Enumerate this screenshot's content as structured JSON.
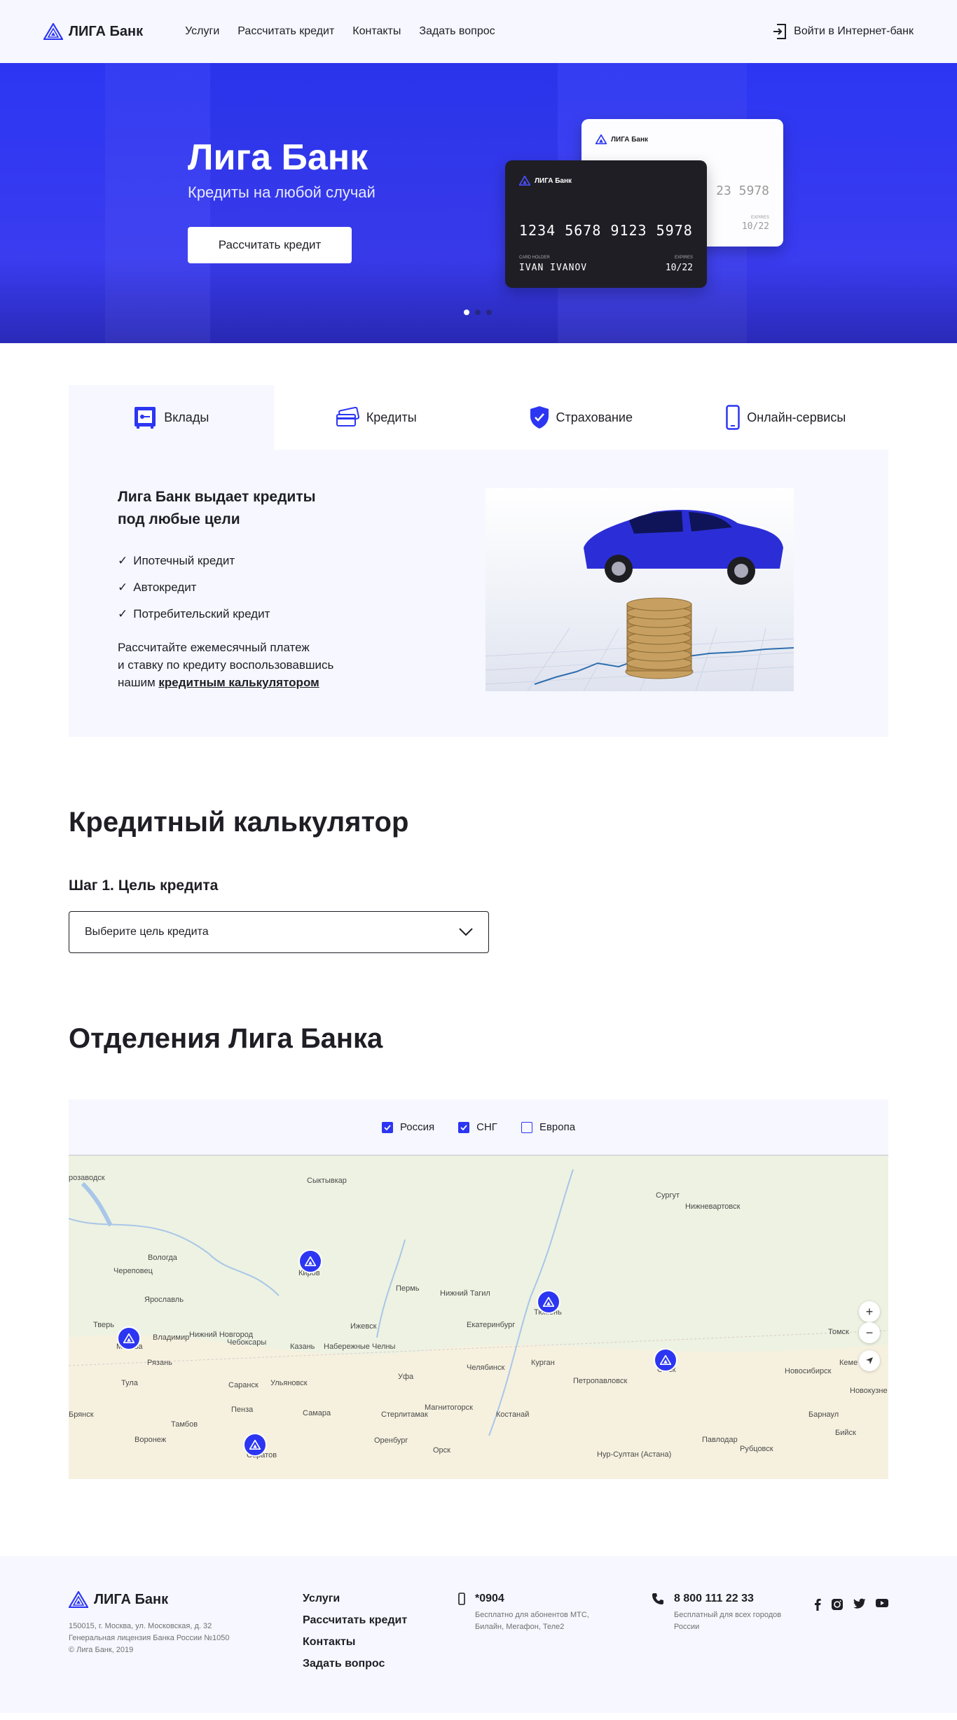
{
  "header": {
    "logo": "ЛИГА Банк",
    "nav": [
      "Услуги",
      "Рассчитать кредит",
      "Контакты",
      "Задать вопрос"
    ],
    "login": "Войти в Интернет-банк"
  },
  "hero": {
    "title": "Лига Банк",
    "subtitle": "Кредиты на любой случай",
    "button": "Рассчитать кредит",
    "card_dark": {
      "brand": "ЛИГА Банк",
      "number": "1234  5678  9123  5978",
      "holder_label": "CARD HOLDER",
      "holder": "IVAN IVANOV",
      "expires_label": "EXPIRES",
      "expires": "10/22"
    },
    "card_white": {
      "brand": "ЛИГА Банк",
      "number": "23 5978",
      "expires_label": "EXPIRES",
      "expires": "10/22"
    },
    "slides_total": 3,
    "slide_active": 1
  },
  "services": {
    "tabs": [
      "Вклады",
      "Кредиты",
      "Страхование",
      "Онлайн-сервисы"
    ],
    "active_tab": "Вклады",
    "panel": {
      "title": "Лига Банк выдает кредиты под любые цели",
      "list": [
        "Ипотечный кредит",
        "Автокредит",
        "Потребительский кредит"
      ],
      "text_line1": "Рассчитайте ежемесячный платеж",
      "text_line2": "и ставку по кредиту воспользовавшись",
      "text_line3": "нашим",
      "link": "кредитным калькулятором"
    }
  },
  "calculator": {
    "title": "Кредитный калькулятор",
    "step": "Шаг 1. Цель кредита",
    "select_placeholder": "Выберите цель кредита"
  },
  "branches": {
    "title": "Отделения Лига Банка",
    "filters": [
      {
        "label": "Россия",
        "checked": true
      },
      {
        "label": "СНГ",
        "checked": true
      },
      {
        "label": "Европа",
        "checked": false
      }
    ],
    "map_labels": [
      "розаводск",
      "Сыктывкар",
      "Сургут",
      "Нижневартовск",
      "Вологда",
      "Череповец",
      "Киров",
      "Пермь",
      "Нижний Тагил",
      "Тюмень",
      "Ярославль",
      "Тверь",
      "Ижевск",
      "Екатеринбург",
      "Томск",
      "Москва",
      "Владимир",
      "Нижний Новгород",
      "Чебоксары",
      "Казань",
      "Набережные Челны",
      "Рязань",
      "Уфа",
      "Челябинск",
      "Курган",
      "Омск",
      "Новосибирск",
      "Кеме",
      "Тула",
      "Саранск",
      "Ульяновск",
      "Петропавловск",
      "Новокузне",
      "Брянск",
      "Пенза",
      "Самара",
      "Стерлитамак",
      "Магнитогорск",
      "Костанай",
      "Барнаул",
      "Бийск",
      "Тамбов",
      "Воронеж",
      "Саратов",
      "Оренбург",
      "Орск",
      "Павлодар",
      "Рубцовск",
      "Нур-Султан (Астана)"
    ],
    "zoom_in": "+",
    "zoom_out": "−"
  },
  "footer": {
    "logo": "ЛИГА Банк",
    "address1": "150015, г. Москва, ул. Московская, д. 32",
    "address2": "Генеральная лицензия Банка России №1050",
    "address3": "© Лига Банк, 2019",
    "nav": [
      "Услуги",
      "Рассчитать кредит",
      "Контакты",
      "Задать вопрос"
    ],
    "short_number": "*0904",
    "short_desc": "Бесплатно для абонентов МТС, Билайн, Мегафон, Теле2",
    "phone": "8 800 111 22 33",
    "phone_desc": "Бесплатный для всех городов России",
    "socials": [
      "facebook-icon",
      "instagram-icon",
      "twitter-icon",
      "youtube-icon"
    ]
  },
  "colors": {
    "accent": "#2c36f2",
    "text": "#1f1e25",
    "light_bg": "#f6f7ff"
  }
}
